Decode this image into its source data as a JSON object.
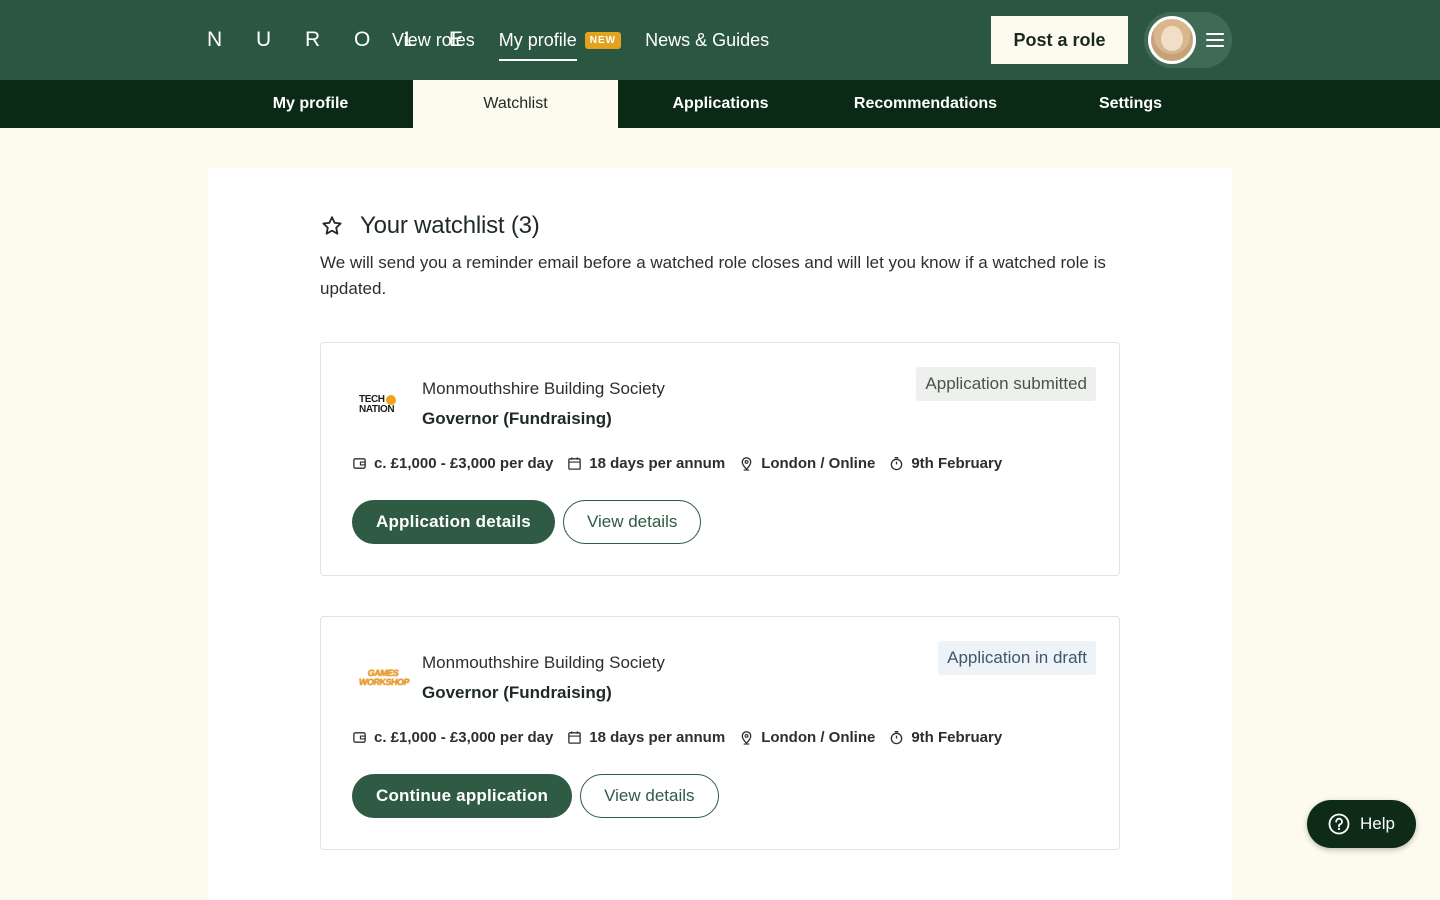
{
  "header": {
    "logo": "N U R O L E",
    "nav": [
      {
        "label": "View roles"
      },
      {
        "label": "My profile",
        "badge": "NEW"
      },
      {
        "label": "News & Guides"
      }
    ],
    "post_role_label": "Post a role",
    "menu_icon": "hamburger-icon"
  },
  "subnav": {
    "tabs": [
      "My profile",
      "Watchlist",
      "Applications",
      "Recommendations",
      "Settings"
    ],
    "active": "Watchlist"
  },
  "watchlist": {
    "title": "Your watchlist (3)",
    "intro": "We will send you a reminder email before a watched role closes and will let you know if a watched role is updated.",
    "roles": [
      {
        "org": "Monmouthshire Building Society",
        "title": "Governor (Fundraising)",
        "status": "Application submitted",
        "logo_text": [
          "TECH",
          "NATION"
        ],
        "pay": "c. £1,000 - £3,000 per day",
        "time": "18 days per annum",
        "location": "London / Online",
        "deadline": "9th February",
        "primary_action": "Application details",
        "secondary_action": "View details"
      },
      {
        "org": "Monmouthshire Building Society",
        "title": "Governor (Fundraising)",
        "status": "Application in draft",
        "logo_text": [
          "GAMES",
          "WORKSHOP"
        ],
        "pay": "c. £1,000 - £3,000 per day",
        "time": "18 days per annum",
        "location": "London / Online",
        "deadline": "9th February",
        "primary_action": "Continue application",
        "secondary_action": "View details"
      }
    ]
  },
  "help": {
    "label": "Help"
  },
  "colors": {
    "header_bg": "#2b5641",
    "subnav_bg": "#0b2a16",
    "page_bg": "#fdfaee",
    "primary": "#2f5a44",
    "badge": "#e4a21f"
  }
}
